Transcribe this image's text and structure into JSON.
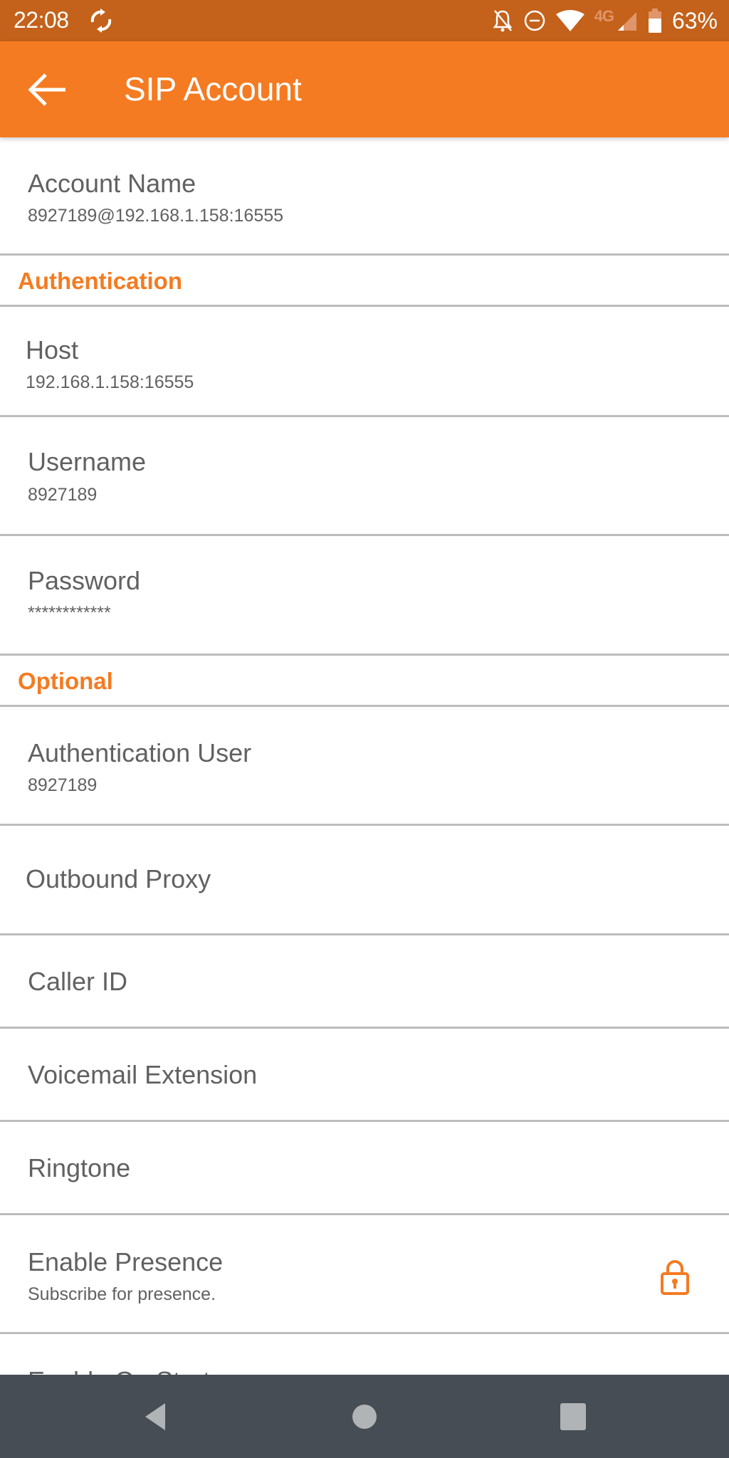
{
  "status_bar": {
    "time": "22:08",
    "battery_percent": "63%",
    "network_label": "4G",
    "icons": [
      "sync-icon",
      "notifications-off-icon",
      "do-not-disturb-icon",
      "wifi-icon",
      "lte-4g-icon",
      "cell-signal-icon",
      "battery-icon"
    ]
  },
  "app_bar": {
    "title": "SIP Account",
    "back_icon": "arrow-back-icon"
  },
  "colors": {
    "accent": "#f47b22",
    "status_bar": "#c4611a",
    "nav_bar": "#464d54",
    "text": "#616161",
    "divider": "#bdbdbd"
  },
  "account": {
    "label": "Account Name",
    "value": "8927189@192.168.1.158:16555"
  },
  "sections": [
    {
      "title": "Authentication",
      "items": [
        {
          "label": "Host",
          "value": "192.168.1.158:16555"
        },
        {
          "label": "Username",
          "value": "8927189"
        },
        {
          "label": "Password",
          "value": "************"
        }
      ]
    },
    {
      "title": "Optional",
      "items": [
        {
          "label": "Authentication User",
          "value": "8927189"
        },
        {
          "label": "Outbound Proxy"
        },
        {
          "label": "Caller ID"
        },
        {
          "label": "Voicemail Extension"
        },
        {
          "label": "Ringtone"
        },
        {
          "label": "Enable Presence",
          "value": "Subscribe for presence.",
          "icon": "lock-icon"
        },
        {
          "label": "Enable On Start"
        }
      ]
    }
  ],
  "nav_bar": {
    "buttons": [
      "back-nav",
      "home-nav",
      "recents-nav"
    ]
  }
}
